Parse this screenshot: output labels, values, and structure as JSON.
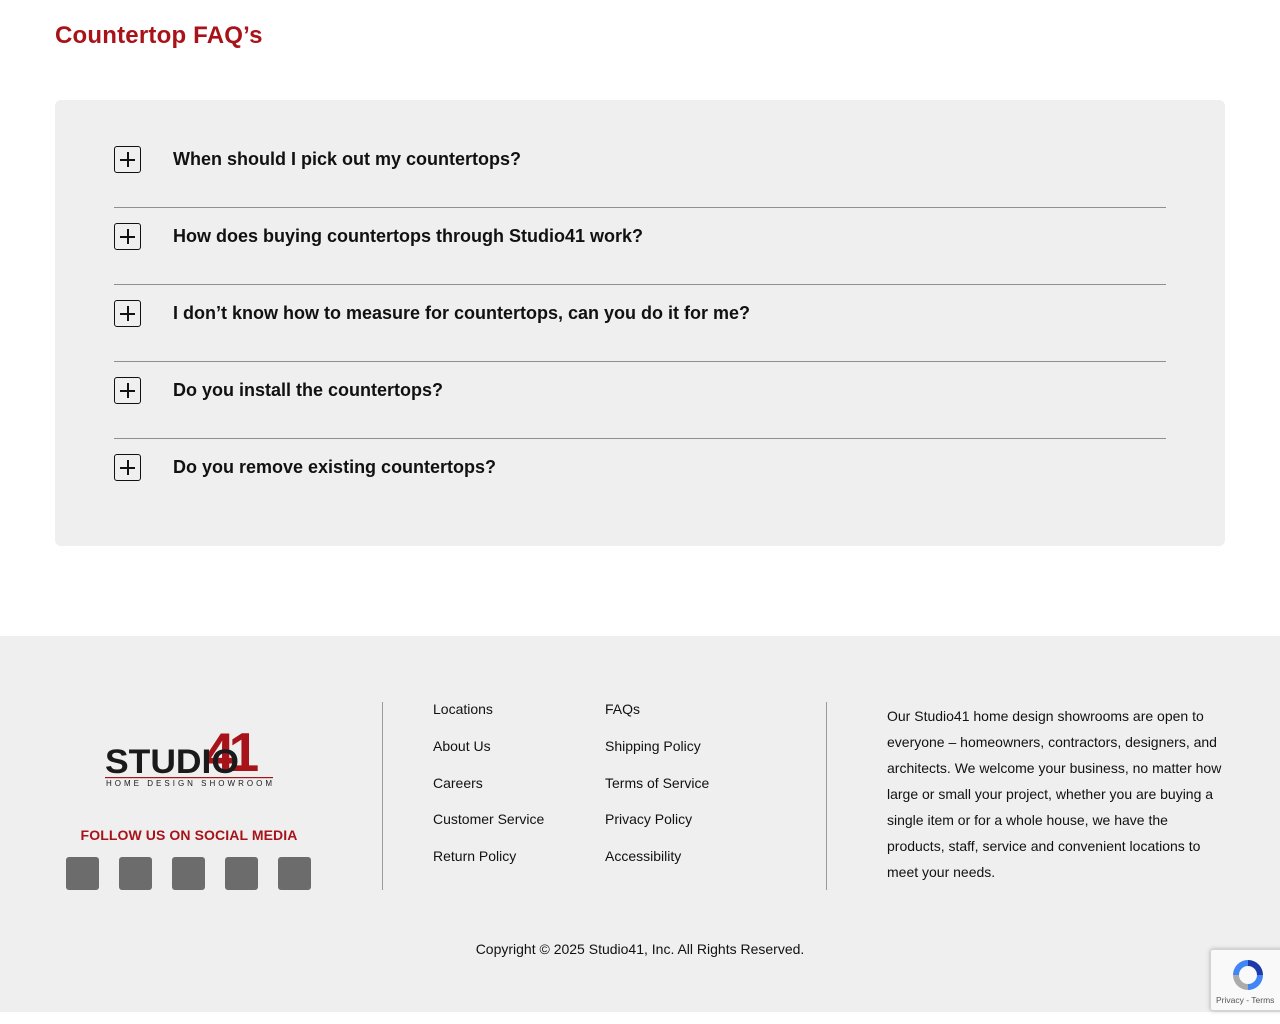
{
  "page": {
    "title": "Countertop FAQ’s"
  },
  "faq": {
    "items": [
      {
        "question": "When should I pick out my countertops?"
      },
      {
        "question": "How does buying countertops through Studio41 work?"
      },
      {
        "question": "I don’t know how to measure for countertops, can you do it for me?"
      },
      {
        "question": "Do you install the countertops?"
      },
      {
        "question": "Do you remove existing countertops?"
      }
    ],
    "toggle_icon": "plus-box-icon"
  },
  "footer": {
    "logo": {
      "word": "STUDIO",
      "number": "41",
      "tagline": "HOME DESIGN SHOWROOM"
    },
    "social_heading": "FOLLOW US ON SOCIAL MEDIA",
    "social_icons": [
      "facebook-icon",
      "instagram-icon",
      "pinterest-icon",
      "youtube-icon",
      "linkedin-icon"
    ],
    "social_glyph": "",
    "links_col1": [
      "Locations",
      "About Us",
      "Careers",
      "Customer Service",
      "Return Policy"
    ],
    "links_col2": [
      "FAQs",
      "Shipping Policy",
      "Terms of Service",
      "Privacy Policy",
      "Accessibility"
    ],
    "about": "Our Studio41 home design showrooms are open to everyone – homeowners, contractors, designers, and architects. We welcome your business, no matter how large or small your project, whether you are buying a single item or for a whole house, we have the products, staff, service and convenient locations to meet your needs.",
    "copyright": "Copyright © 2025 Studio41, Inc. All Rights Reserved."
  },
  "recaptcha": {
    "terms": "Privacy - Terms"
  },
  "colors": {
    "brand_red": "#a8131a",
    "panel_bg": "#efefef",
    "social_bg": "#6c6c6c"
  }
}
